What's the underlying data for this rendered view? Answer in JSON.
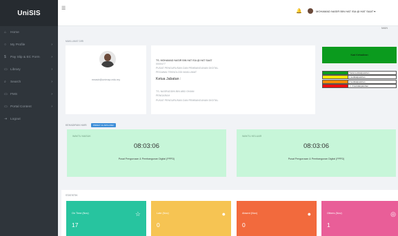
{
  "app": {
    "logo": "UniSIS"
  },
  "sidebar": {
    "items": [
      {
        "label": "Home",
        "icon": "home-icon",
        "glyph": "⌂",
        "chevron": ""
      },
      {
        "label": "My Profile",
        "icon": "user-icon",
        "glyph": "○",
        "chevron": "›"
      },
      {
        "label": "Pay Slip & EC Form",
        "icon": "dollar-icon",
        "glyph": "$",
        "chevron": "›"
      },
      {
        "label": "Library",
        "icon": "book-icon",
        "glyph": "▭",
        "chevron": "›"
      },
      {
        "label": "Search",
        "icon": "search-icon",
        "glyph": "⌕",
        "chevron": "›"
      },
      {
        "label": "FMS",
        "icon": "folder-icon",
        "glyph": "▭",
        "chevron": "›"
      },
      {
        "label": "Portal Content",
        "icon": "content-icon",
        "glyph": "▭",
        "chevron": "›"
      },
      {
        "label": "Logout",
        "icon": "logout-icon",
        "glyph": "⇥",
        "chevron": ""
      }
    ]
  },
  "topbar": {
    "menu_icon": "☰",
    "bell_icon": "🔔",
    "user_name": "MOHAMAD NASIR BIN HAT ISA @ HAT SAAT ▾"
  },
  "main": {
    "tag": "MAIN"
  },
  "profile": {
    "section_title": "MAKLUMAT DIRI",
    "email": "mnasir@unimap.edu.my",
    "name": "TS. MOHAMAD NASIR BIN HAT ISA @ HAT SAAT",
    "id": "0000477",
    "dept": "PUSAT PENGURUSAN DAN PEMBANGUNAN DIGITAL",
    "position": "PEGAWAI TEKNOLOGI MAKLUMAT",
    "ketua_label": "Ketua Jabatan :",
    "ketua_name": "TS. NASRUDDIN BIN ABD GHANI",
    "ketua_role": "PENGARAH",
    "ketua_dept": "PUSAT PENGURUSAN DAN PEMBANGUNAN DIGITAL"
  },
  "legend": {
    "title": "Kad Kehadiran",
    "items": [
      {
        "color": "#0b9b1e",
        "label": "Tiada ketidakpatuhan"
      },
      {
        "color": "#ffe900",
        "label": "1 ketidakpatuhan"
      },
      {
        "color": "#ff8c00",
        "label": "2 ketidakpatuhan"
      },
      {
        "color": "#ee1111",
        "label": ">= 3 ketidakpatuhan"
      }
    ]
  },
  "attendance": {
    "section_title": "KEHADIRAN HARI",
    "date_badge": "PRIDAY 11-NOV-2022",
    "masuk": {
      "title": "WAKTU MASUK",
      "time": "08:03:06",
      "place": "Pusat Pengurusan & Pembangunan Digital (PPPD)"
    },
    "keluar": {
      "title": "WAKTU KELUAR",
      "time": "08:03:06",
      "place": "Pusat Pengurusan & Pembangunan Digital (PPPD)"
    }
  },
  "stats": {
    "section_title": "STATISTIK",
    "cards": [
      {
        "label": "On Time (Nov)",
        "value": "17",
        "color": "#27c49f",
        "icon": "star-icon",
        "glyph": "☆"
      },
      {
        "label": "Late (Nov)",
        "value": "0",
        "color": "#f6c453",
        "icon": "clock-icon",
        "glyph": "●"
      },
      {
        "label": "Absent (Nov)",
        "value": "0",
        "color": "#f26a3d",
        "icon": "absent-icon",
        "glyph": "●"
      },
      {
        "label": "Others (Nov)",
        "value": "1",
        "color": "#e95e98",
        "icon": "others-icon",
        "glyph": "◎"
      }
    ]
  }
}
